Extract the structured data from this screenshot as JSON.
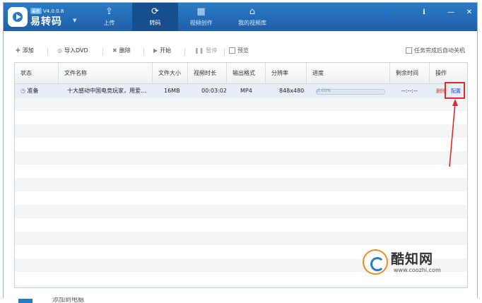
{
  "app": {
    "version_badge": "最新",
    "version": "V4.0.0.8",
    "name": "易转码"
  },
  "nav": [
    {
      "label": "上传"
    },
    {
      "label": "转码"
    },
    {
      "label": "视频创作"
    },
    {
      "label": "我的视频库"
    }
  ],
  "toolbar": {
    "add": "添加",
    "import_dvd": "导入DVD",
    "delete": "删除",
    "start": "开始",
    "pause": "暂停",
    "preview": "预览",
    "auto_shutdown": "任务完成后自动关机"
  },
  "table": {
    "headers": [
      "状态",
      "文件名称",
      "文件大小",
      "视频时长",
      "输出格式",
      "分辨率",
      "进度",
      "剩余时间",
      "操作"
    ],
    "row": {
      "status": "准备",
      "filename": "十大感动中国电竞玩家，用爱...",
      "size": "16MB",
      "duration": "00:03:02",
      "format": "MP4",
      "resolution": "848x480",
      "progress_text": "0.00%",
      "progress": 0.8,
      "remaining": "--:--:--",
      "action_delete": "删除",
      "action_config": "配置"
    }
  },
  "watermark": {
    "name": "酷知网",
    "url": "www.coozhi.com"
  },
  "bottom": {
    "text": "添加到电脑"
  },
  "colors": {
    "titlebar": "#1d5fa8",
    "highlight": "#e02c2c",
    "delete_red": "#d63a2e",
    "config_blue": "#1a47c7"
  }
}
